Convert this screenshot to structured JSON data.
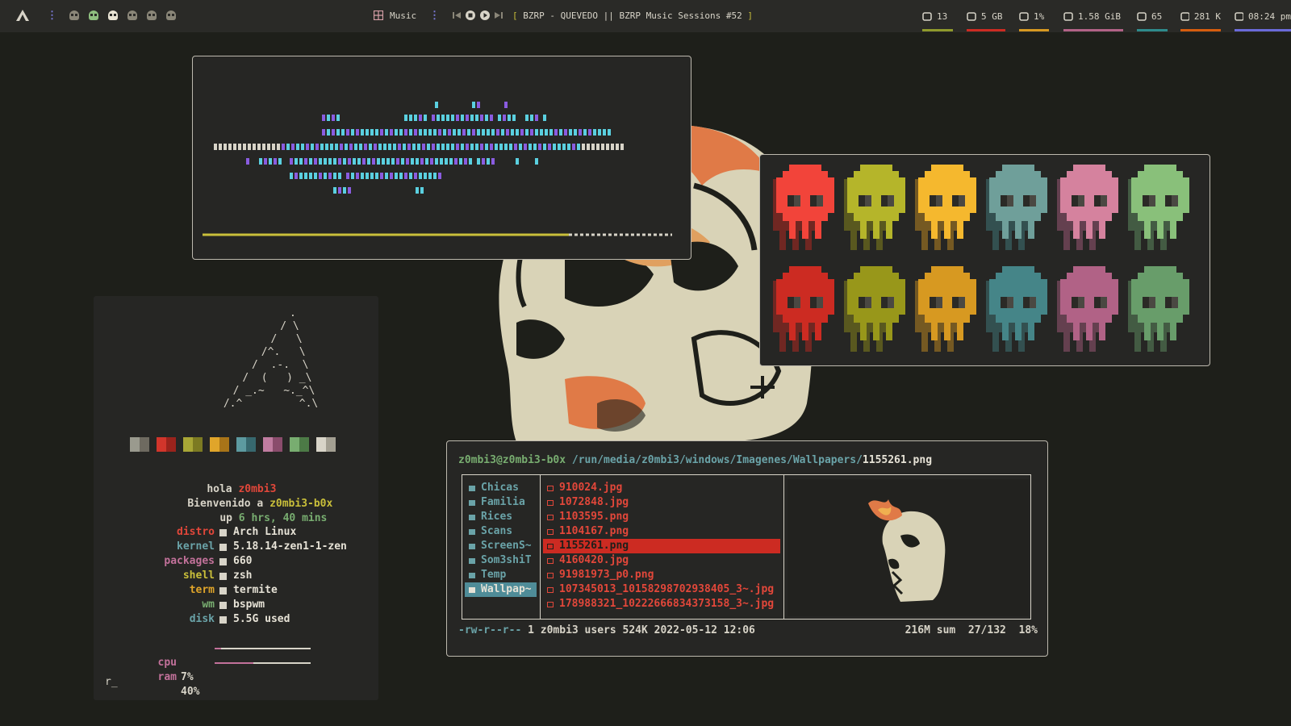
{
  "colors": {
    "background": "#1e1f1a",
    "bar_bg": "#2a2a27",
    "red": "#cc2b22",
    "yellow": "#c9bf3a",
    "teal": "#4f8c98",
    "pink": "#c2719a",
    "green": "#6f9f65"
  },
  "topbar": {
    "launcher_icon": "arch-logo-icon",
    "workspaces": [
      {
        "icon": "skull-icon",
        "state": "empty"
      },
      {
        "icon": "skull-icon",
        "state": "occupied"
      },
      {
        "icon": "skull-icon",
        "state": "active"
      },
      {
        "icon": "skull-icon",
        "state": "empty"
      },
      {
        "icon": "skull-icon",
        "state": "empty"
      },
      {
        "icon": "skull-icon",
        "state": "empty"
      }
    ],
    "window_icon": "grid-icon",
    "window_title": "Music",
    "player": {
      "prev_icon": "skip-previous-icon",
      "stop_icon": "stop-icon",
      "play_icon": "play-icon",
      "next_icon": "skip-next-icon",
      "track": "[ BZRP - QUEVEDO || BZRP Music Sessions #52 ]"
    },
    "stats": [
      {
        "icon": "updates-icon",
        "value": "13",
        "color": "#8f9a2c"
      },
      {
        "icon": "disk-icon",
        "value": "5 GB",
        "color": "#cc2b22"
      },
      {
        "icon": "cpu-icon",
        "value": "1%",
        "color": "#d79921"
      },
      {
        "icon": "memory-icon",
        "value": "1.58 GiB",
        "color": "#b16286"
      },
      {
        "icon": "volume-icon",
        "value": "65",
        "color": "#2e8b8b"
      },
      {
        "icon": "wifi-icon",
        "value": "281 K",
        "color": "#d65d0e"
      },
      {
        "icon": "clock-icon",
        "value": "08:24 pm",
        "color": "#6a6ad8"
      }
    ]
  },
  "visualizer": {
    "progress": 0.78,
    "colors": [
      "#5ad0e0",
      "#8a5ce0",
      "#d8d4c8"
    ]
  },
  "palette": {
    "bright": [
      "#f2443a",
      "#b5b52a",
      "#f5b82e",
      "#6f9f9a",
      "#d5829e",
      "#89c07a"
    ],
    "dark": [
      "#cc2b22",
      "#98971a",
      "#d79921",
      "#458588",
      "#b16286",
      "#689d6a"
    ]
  },
  "neofetch": {
    "ascii_art": "                  .\n                 / \\\n                /   \\\n               /^.   \\\n              /  .-.  \\\n             /  (   ) _\\\n            / _.~   ~._^\\\n           /.^         ^.\\",
    "swatch_colors": [
      [
        "#9a9a8e",
        "#6e6a60"
      ],
      [
        "#d1352b",
        "#9a231c"
      ],
      [
        "#a8a636",
        "#7c7a22"
      ],
      [
        "#e0a52a",
        "#a87418"
      ],
      [
        "#5d9aa0",
        "#37686e"
      ],
      [
        "#c07ca0",
        "#8a4c6c"
      ],
      [
        "#78ad70",
        "#4c7a46"
      ],
      [
        "#d8d4c8",
        "#a39f92"
      ]
    ],
    "greeting_prefix": "hola",
    "user": "z0mbi3",
    "welcome_prefix": "Bienvenido a",
    "host": "z0mbi3-b0x",
    "up_prefix": "up",
    "uptime": "6 hrs, 40 mins",
    "info": [
      {
        "key": "distro",
        "value": "Arch Linux",
        "color": "#e2473a"
      },
      {
        "key": "kernel",
        "value": "5.18.14-zen1-1-zen",
        "color": "#6aa3a8"
      },
      {
        "key": "packages",
        "value": "660",
        "color": "#c2719a"
      },
      {
        "key": "shell",
        "value": "zsh",
        "color": "#c9bf3a"
      },
      {
        "key": "term",
        "value": "termite",
        "color": "#e0a52a"
      },
      {
        "key": "wm",
        "value": "bspwm",
        "color": "#78ad70"
      },
      {
        "key": "disk",
        "value": "5.5G used",
        "color": "#6aa3a8"
      }
    ],
    "cpu_label": "cpu",
    "cpu_value": "7%",
    "cpu_fraction": 0.07,
    "ram_label": "ram",
    "ram_value": "40%",
    "ram_fraction": 0.4,
    "prompt": "r_"
  },
  "ranger": {
    "user_host": "z0mbi3@z0mbi3-b0x",
    "dir": "/run/media/z0mbi3/windows/Imagenes/Wallpapers/",
    "file": "1155261.png",
    "folders": [
      "Chicas",
      "Familia",
      "Rices",
      "Scans",
      "ScreenS~",
      "Som3shiT",
      "Temp",
      "Wallpap~"
    ],
    "selected_folder": 7,
    "files": [
      "910024.jpg",
      "1072848.jpg",
      "1103595.png",
      "1104167.png",
      "1155261.png",
      "4160420.jpg",
      "91981973_p0.png",
      "107345013_10158298702938405_3~.jpg",
      "178988321_10222666834373158_3~.jpg"
    ],
    "selected_file": 4,
    "perms": "-rw-r--r--",
    "file_meta": "1 z0mbi3 users 524K 2022-05-12 12:06",
    "summary": "216M sum",
    "position": "27/132",
    "percent": "18%"
  }
}
